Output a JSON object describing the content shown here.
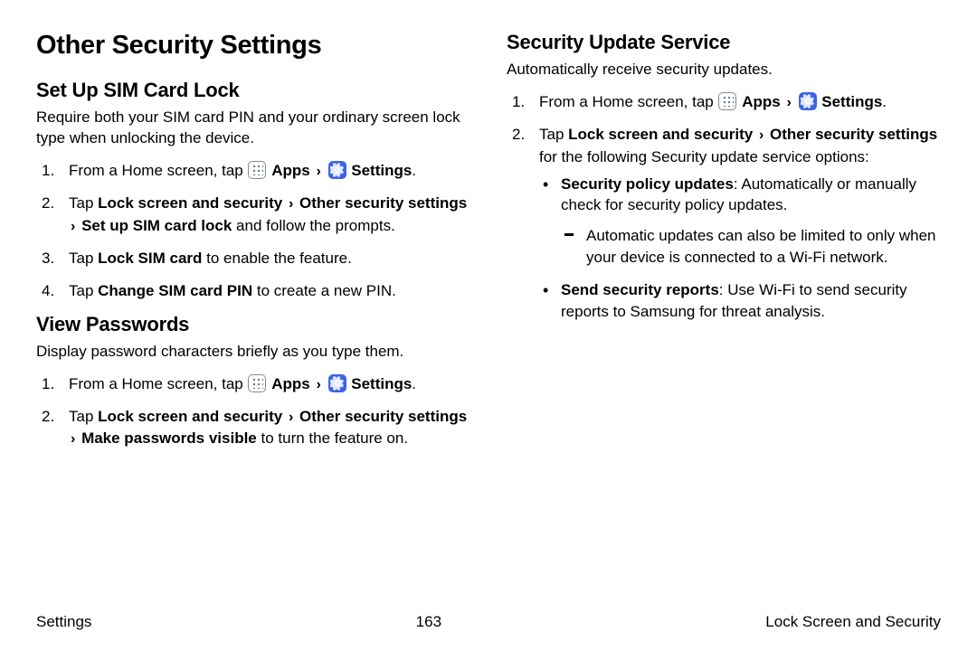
{
  "page_title": "Other Security Settings",
  "left": {
    "sim": {
      "heading": "Set Up SIM Card Lock",
      "desc": "Require both your SIM card PIN and your ordinary screen lock type when unlocking the device.",
      "step1_a": "From a Home screen, tap ",
      "apps": "Apps",
      "settings": "Settings",
      "step2_a": "Tap ",
      "step2_b": "Lock screen and security",
      "step2_c": "Other security settings",
      "step2_d": "Set up SIM card lock",
      "step2_e": " and follow the prompts.",
      "step3_a": "Tap ",
      "step3_b": "Lock SIM card",
      "step3_c": " to enable the feature.",
      "step4_a": "Tap ",
      "step4_b": "Change SIM card PIN",
      "step4_c": " to create a new PIN."
    },
    "view": {
      "heading": "View Passwords",
      "desc": "Display password characters briefly as you type them.",
      "step1_a": "From a Home screen, tap ",
      "apps": "Apps",
      "settings": "Settings",
      "step2_a": "Tap ",
      "step2_b": "Lock screen and security",
      "step2_c": "Other security settings",
      "step2_d": "Make passwords visible",
      "step2_e": " to turn the feature on."
    }
  },
  "right": {
    "sus": {
      "heading": "Security Update Service",
      "desc": "Automatically receive security updates.",
      "step1_a": "From a Home screen, tap ",
      "apps": "Apps",
      "settings": "Settings",
      "step2_a": "Tap ",
      "step2_b": "Lock screen and security",
      "step2_c": "Other security settings",
      "step2_d": " for the following Security update service options:",
      "bullet1_b": "Security policy updates",
      "bullet1_c": ": Automatically or manually check for security policy updates.",
      "dash1": "Automatic updates can also be limited to only when your device is connected to a Wi-Fi network.",
      "bullet2_b": "Send security reports",
      "bullet2_c": ": Use Wi-Fi to send security reports to Samsung for threat analysis."
    }
  },
  "footer": {
    "left": "Settings",
    "center": "163",
    "right": "Lock Screen and Security"
  },
  "period": "."
}
